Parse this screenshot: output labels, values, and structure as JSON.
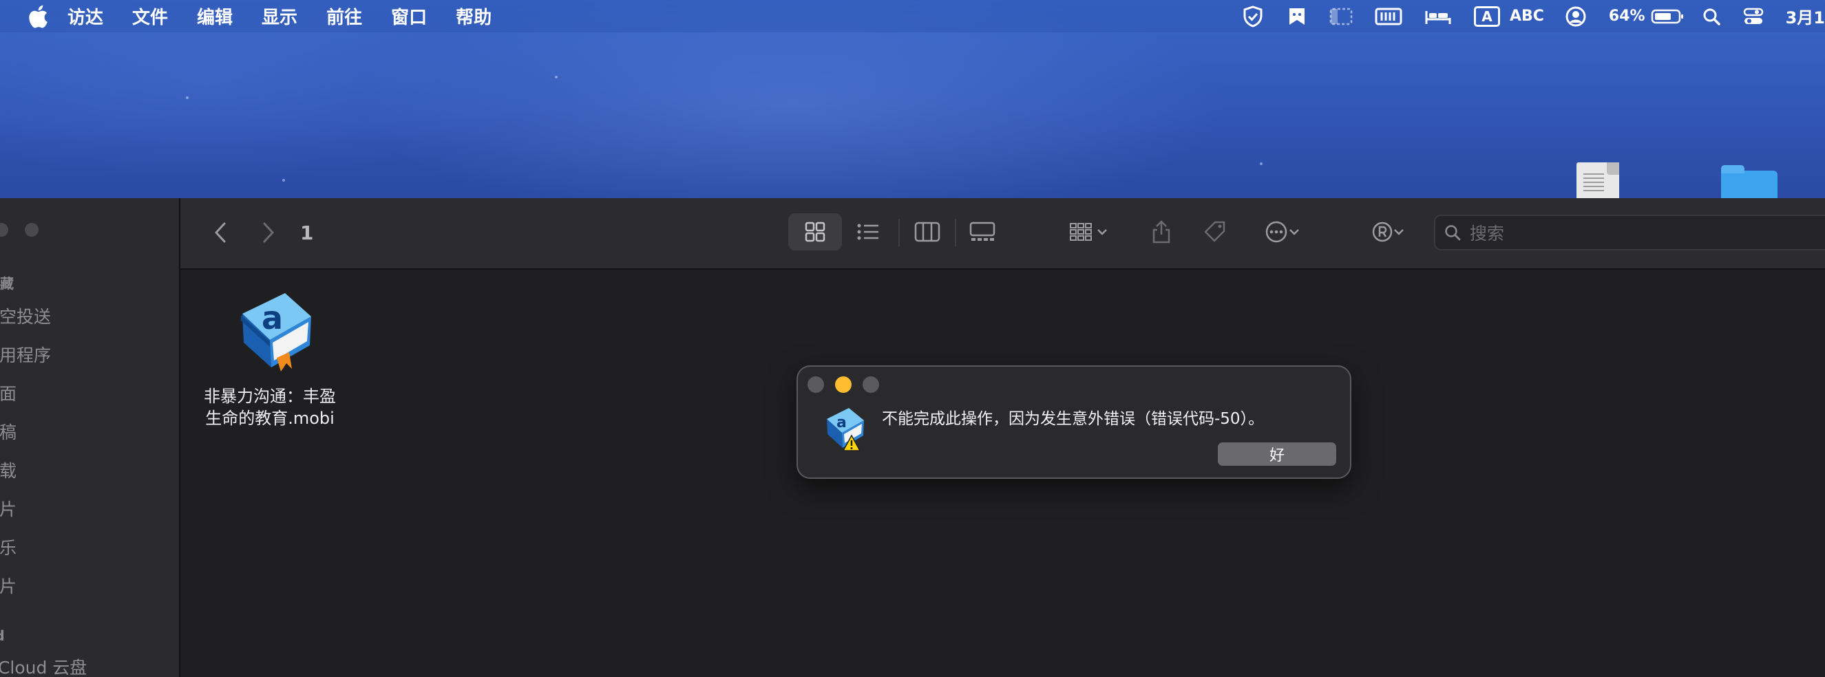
{
  "menubar": {
    "app_name": "访达",
    "items": [
      "文件",
      "编辑",
      "显示",
      "前往",
      "窗口",
      "帮助"
    ],
    "battery_percent": "64%",
    "input_source": "ABC",
    "input_badge": "A",
    "clock": "3月1"
  },
  "sidebar": {
    "favorites_header": "收藏",
    "items": [
      "隔空投送",
      "应用程序",
      "桌面",
      "文稿",
      "下载",
      "影片",
      "音乐",
      "图片"
    ],
    "icloud_header": "iCloud",
    "icloud_items": [
      "iCloud 云盘"
    ]
  },
  "toolbar": {
    "folder_title": "1",
    "search_placeholder": "搜索"
  },
  "files": [
    {
      "name_line1": "非暴力沟通：丰盈",
      "name_line2": "生命的教育.mobi",
      "icon": "ebook-icon"
    }
  ],
  "alert": {
    "message": "不能完成此操作，因为发生意外错误（错误代码-50）。",
    "ok_label": "好",
    "icon": "ebook-warning-icon"
  },
  "colors": {
    "desktop_blue": "#3359b8",
    "window_bg": "#1f1f21",
    "sidebar_bg": "#2b2b2d",
    "minimize_yellow": "#febc2e",
    "button_gray": "#6a6a6e"
  }
}
